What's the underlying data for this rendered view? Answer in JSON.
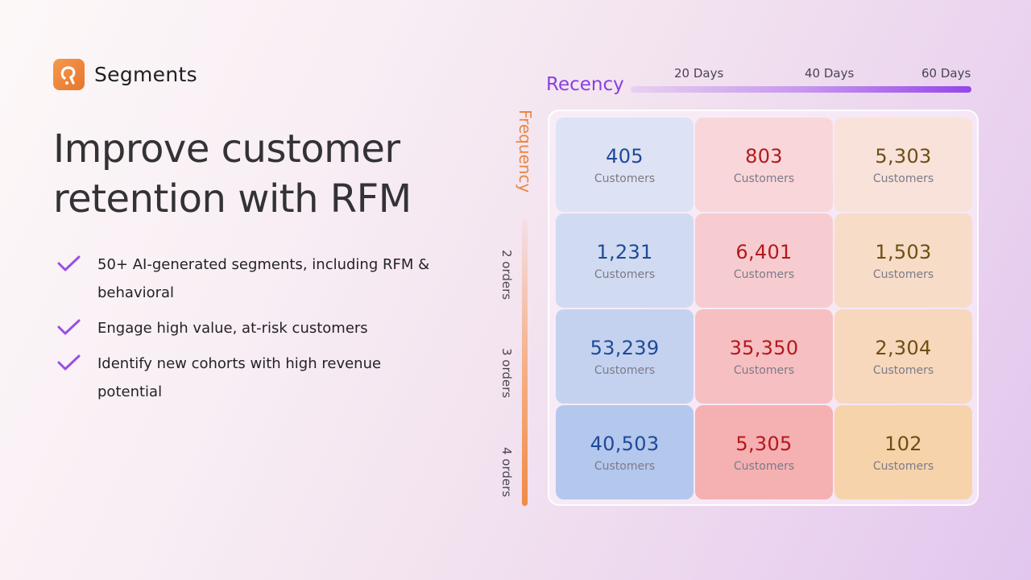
{
  "brand": {
    "name": "Segments",
    "logo_color": "#ee8a3f"
  },
  "headline": {
    "line1": "Improve customer",
    "line2": "retention with RFM"
  },
  "features": [
    {
      "icon": "check-icon",
      "text": "50+ AI-generated segments, including RFM & behavioral"
    },
    {
      "icon": "check-icon",
      "text": "Engage high value, at-risk customers"
    },
    {
      "icon": "check-icon",
      "text": "Identify new cohorts with high revenue potential"
    }
  ],
  "colors": {
    "accent_purple": "#8a3fe0",
    "accent_orange": "#ec8543",
    "blue_value": "#1e4a98",
    "red_value": "#b2191c",
    "amber_value": "#6e4f12"
  },
  "chart_data": {
    "type": "heatmap",
    "title": "",
    "xlabel": "Recency",
    "ylabel": "Frequency",
    "x_ticks": [
      "20 Days",
      "40 Days",
      "60 Days"
    ],
    "y_ticks": [
      "2 orders",
      "3 orders",
      "4 orders"
    ],
    "cell_unit_label": "Customers",
    "rows": [
      {
        "values": [
          405,
          803,
          5303
        ],
        "labels": [
          "405",
          "803",
          "5,303"
        ]
      },
      {
        "values": [
          1231,
          6401,
          1503
        ],
        "labels": [
          "1,231",
          "6,401",
          "1,503"
        ]
      },
      {
        "values": [
          53239,
          35350,
          2304
        ],
        "labels": [
          "53,239",
          "35,350",
          "2,304"
        ]
      },
      {
        "values": [
          40503,
          5305,
          102
        ],
        "labels": [
          "40,503",
          "5,305",
          "102"
        ]
      }
    ],
    "column_color_families": [
      "blue",
      "red",
      "amber"
    ]
  }
}
